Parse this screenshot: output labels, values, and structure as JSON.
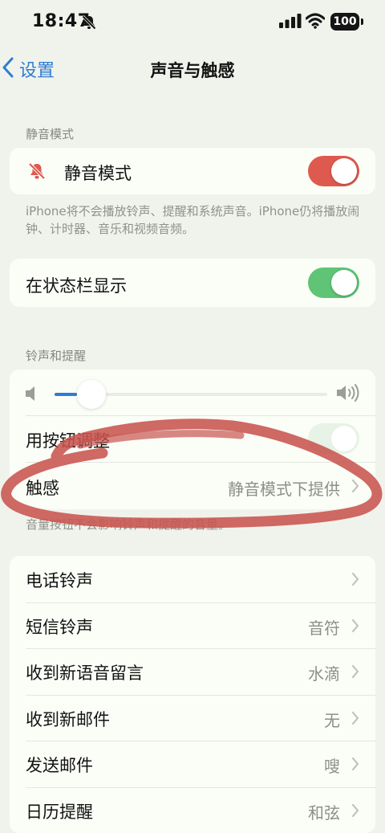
{
  "status_bar": {
    "time": "18:47",
    "battery": "100"
  },
  "nav": {
    "back_label": "设置",
    "title": "声音与触感"
  },
  "silent_section": {
    "header": "静音模式",
    "toggle_label": "静音模式",
    "toggle_on": true,
    "footer": "iPhone将不会播放铃声、提醒和系统声音。iPhone仍将播放闹钟、计时器、音乐和视频音频。"
  },
  "status_bar_section": {
    "toggle_label": "在状态栏显示",
    "toggle_on": true
  },
  "ringer_section": {
    "header": "铃声和提醒",
    "volume_level": 0.1,
    "buttons_label": "用按钮调整",
    "haptics_label": "触感",
    "haptics_value": "静音模式下提供",
    "footer": "音量按钮不会影响铃声和提醒的音量。"
  },
  "sounds_list": [
    {
      "label": "电话铃声",
      "value": ""
    },
    {
      "label": "短信铃声",
      "value": "音符"
    },
    {
      "label": "收到新语音留言",
      "value": "水滴"
    },
    {
      "label": "收到新邮件",
      "value": "无"
    },
    {
      "label": "发送邮件",
      "value": "嗖"
    },
    {
      "label": "日历提醒",
      "value": "和弦"
    }
  ],
  "colors": {
    "accent": "#2f7cd3",
    "silent_toggle": "#de5a4e",
    "on_toggle": "#5fc476",
    "annotation": "#c8544f"
  }
}
